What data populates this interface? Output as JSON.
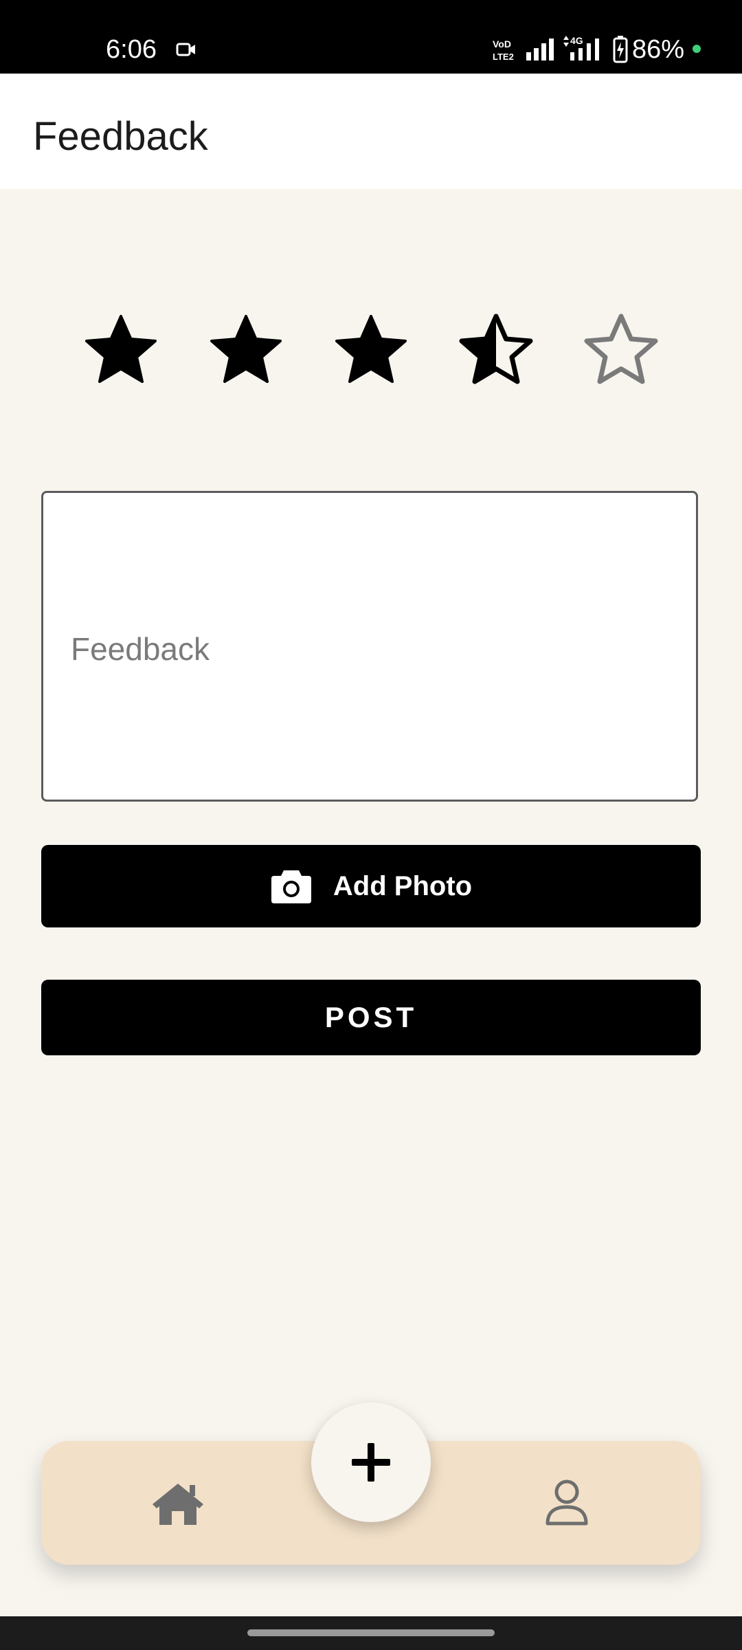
{
  "status_bar": {
    "time": "6:06",
    "battery_percent": "86%",
    "network_label": "4G",
    "icons": [
      "video-camera-icon",
      "volte-icon",
      "signal-icon",
      "signal-4g-icon",
      "battery-charging-icon",
      "notification-dot"
    ]
  },
  "header": {
    "title": "Feedback"
  },
  "rating": {
    "value": 3.5,
    "max": 5,
    "filled_color": "#000000",
    "empty_color": "#7a7a7a"
  },
  "feedback": {
    "placeholder": "Feedback",
    "value": ""
  },
  "actions": {
    "add_photo_label": "Add Photo",
    "post_label": "POST"
  },
  "bottom_nav": {
    "items": [
      {
        "name": "home",
        "icon": "home-icon"
      },
      {
        "name": "add",
        "icon": "plus-icon"
      },
      {
        "name": "profile",
        "icon": "user-icon"
      }
    ],
    "background": "#f2e0c8",
    "icon_color": "#6e6e6e"
  },
  "colors": {
    "page_background": "#f8f5ef",
    "app_bar": "#ffffff",
    "button": "#000000",
    "status_dot": "#3ecf7a"
  }
}
